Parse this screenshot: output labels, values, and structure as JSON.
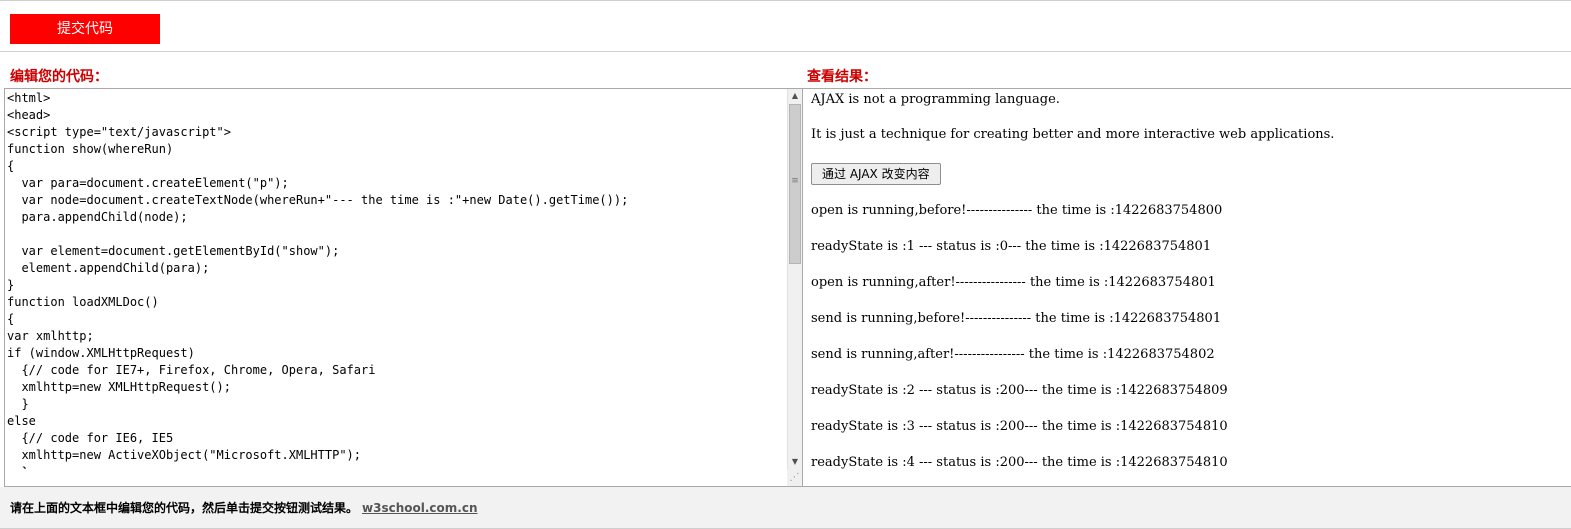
{
  "toolbar": {
    "submit_label": "提交代码"
  },
  "labels": {
    "editor_title": "编辑您的代码：",
    "result_title": "查看结果："
  },
  "editor": {
    "code": "<html>\n<head>\n<script type=\"text/javascript\">\nfunction show(whereRun)\n{\n  var para=document.createElement(\"p\");\n  var node=document.createTextNode(whereRun+\"--- the time is :\"+new Date().getTime());\n  para.appendChild(node);\n\n  var element=document.getElementById(\"show\");\n  element.appendChild(para);\n}\nfunction loadXMLDoc()\n{\nvar xmlhttp;\nif (window.XMLHttpRequest)\n  {// code for IE7+, Firefox, Chrome, Opera, Safari\n  xmlhttp=new XMLHttpRequest();\n  }\nelse\n  {// code for IE6, IE5\n  xmlhttp=new ActiveXObject(\"Microsoft.XMLHTTP\");\n  }"
  },
  "result": {
    "line1": "AJAX is not a programming language.",
    "line2": "It is just a technique for creating better and more interactive web applications.",
    "button_label": "通过 AJAX 改变内容",
    "log": [
      "open is running,before!--------------- the time is :1422683754800",
      "readyState is :1 --- status is :0--- the time is :1422683754801",
      "open is running,after!---------------- the time is :1422683754801",
      "send is running,before!--------------- the time is :1422683754801",
      "send is running,after!---------------- the time is :1422683754802",
      "readyState is :2 --- status is :200--- the time is :1422683754809",
      "readyState is :3 --- status is :200--- the time is :1422683754810",
      "readyState is :4 --- status is :200--- the time is :1422683754810"
    ]
  },
  "footer": {
    "instruction": "请在上面的文本框中编辑您的代码，然后单击提交按钮测试结果。",
    "site_link": "w3school.com.cn"
  },
  "colors": {
    "accent": "#ff0000",
    "label": "#cc0000"
  }
}
